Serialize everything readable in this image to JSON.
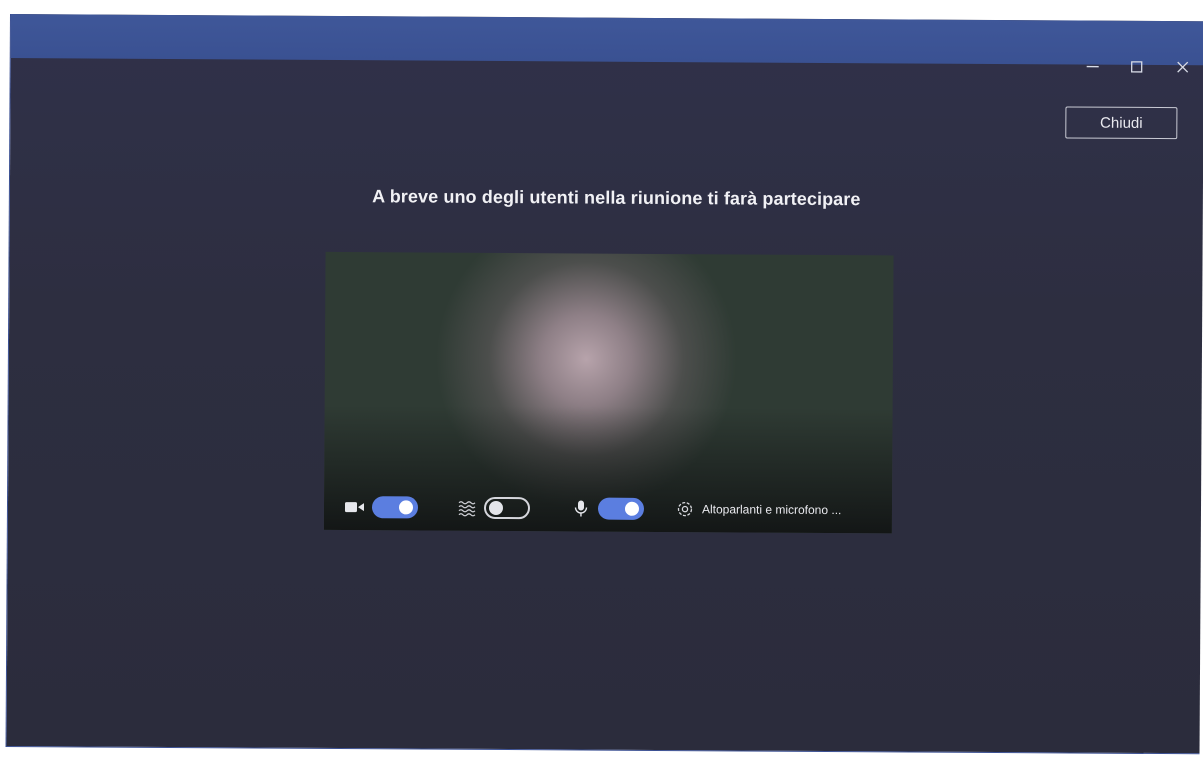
{
  "window": {
    "minimize_icon": "minimize-icon",
    "maximize_icon": "maximize-icon",
    "close_icon": "close-icon",
    "accent_color": "#3d5597",
    "background_color": "#2e2f3e"
  },
  "header": {
    "close_label": "Chiudi"
  },
  "main": {
    "message": "A breve uno degli utenti nella riunione ti farà partecipare"
  },
  "preview_controls": {
    "camera": {
      "icon": "camera-icon",
      "state": "on"
    },
    "background_blur": {
      "icon": "background-blur-icon",
      "state": "off"
    },
    "microphone": {
      "icon": "microphone-icon",
      "state": "on"
    },
    "device_settings": {
      "icon": "gear-icon",
      "label": "Altoparlanti e microfono ..."
    },
    "toggle_color": "#5b7ee0"
  }
}
